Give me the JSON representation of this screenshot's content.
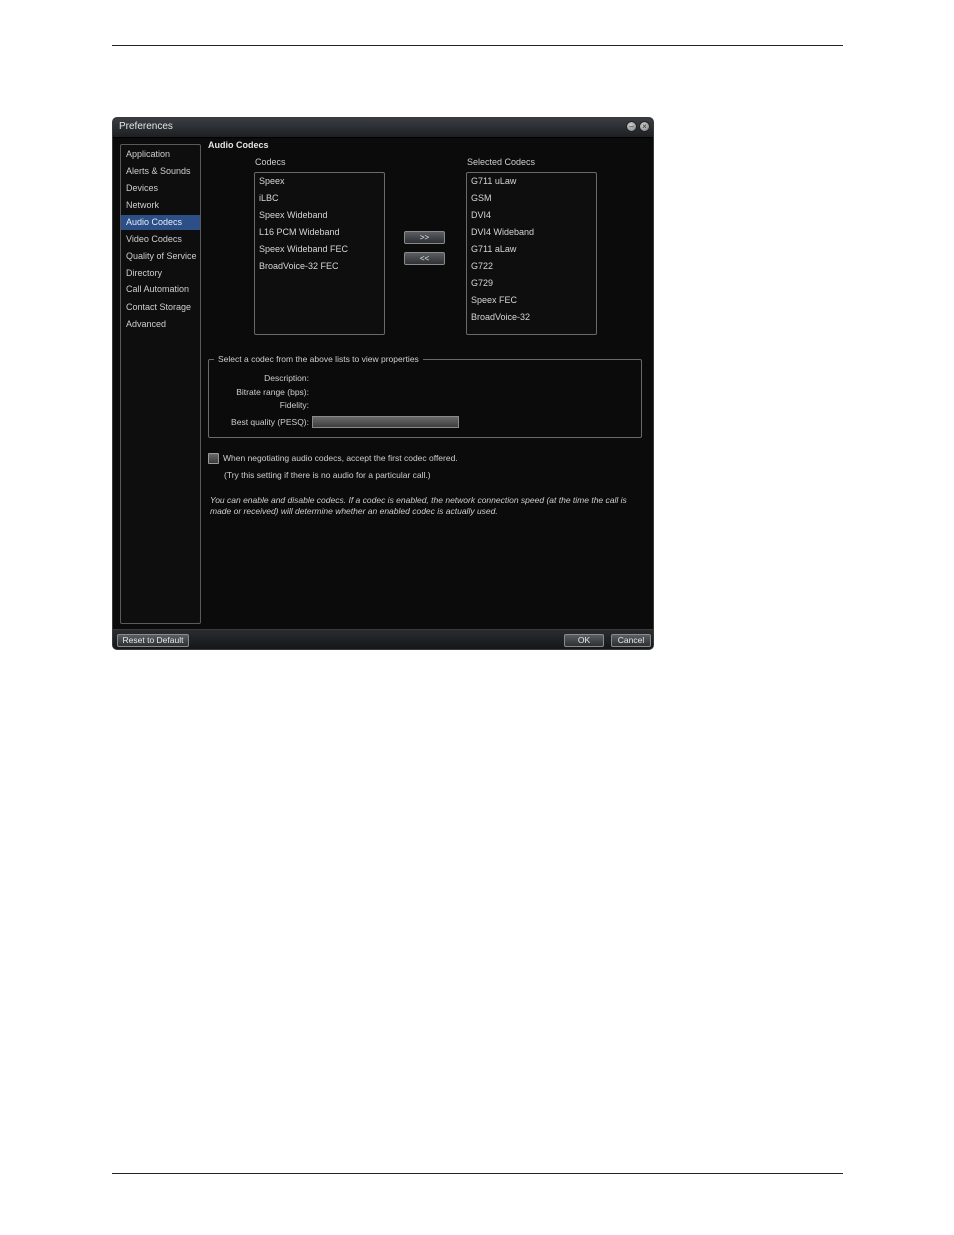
{
  "window": {
    "title": "Preferences"
  },
  "nav": {
    "items": [
      {
        "label": "Application"
      },
      {
        "label": "Alerts & Sounds"
      },
      {
        "label": "Devices"
      },
      {
        "label": "Network"
      },
      {
        "label": "Audio Codecs",
        "active": true
      },
      {
        "label": "Video Codecs"
      },
      {
        "label": "Quality of Service"
      },
      {
        "label": "Directory"
      },
      {
        "label": "Call Automation"
      },
      {
        "label": "Contact Storage"
      },
      {
        "label": "Advanced"
      }
    ]
  },
  "section": {
    "title": "Audio Codecs"
  },
  "codecs": {
    "label": "Codecs",
    "items": [
      "Speex",
      "iLBC",
      "Speex Wideband",
      "L16 PCM Wideband",
      "Speex Wideband FEC",
      "BroadVoice-32 FEC"
    ]
  },
  "selected": {
    "label": "Selected Codecs",
    "items": [
      "G711 uLaw",
      "GSM",
      "DVI4",
      "DVI4 Wideband",
      "G711 aLaw",
      "G722",
      "G729",
      "Speex FEC",
      "BroadVoice-32"
    ]
  },
  "buttons": {
    "add": ">>",
    "remove": "<<",
    "reset": "Reset to Default",
    "ok": "OK",
    "cancel": "Cancel"
  },
  "properties": {
    "legend": "Select a codec from the above lists to view properties",
    "description": "Description:",
    "bitrate": "Bitrate range (bps):",
    "fidelity": "Fidelity:",
    "pesq": "Best quality (PESQ):"
  },
  "option": {
    "label": "When negotiating audio codecs, accept the first codec offered.",
    "hint": "(Try this setting if there is no audio for a particular call.)",
    "checked": false
  },
  "note": "You can enable and disable codecs. If a codec is enabled, the network connection speed (at the time the call is made or received) will determine whether an enabled codec is actually used."
}
